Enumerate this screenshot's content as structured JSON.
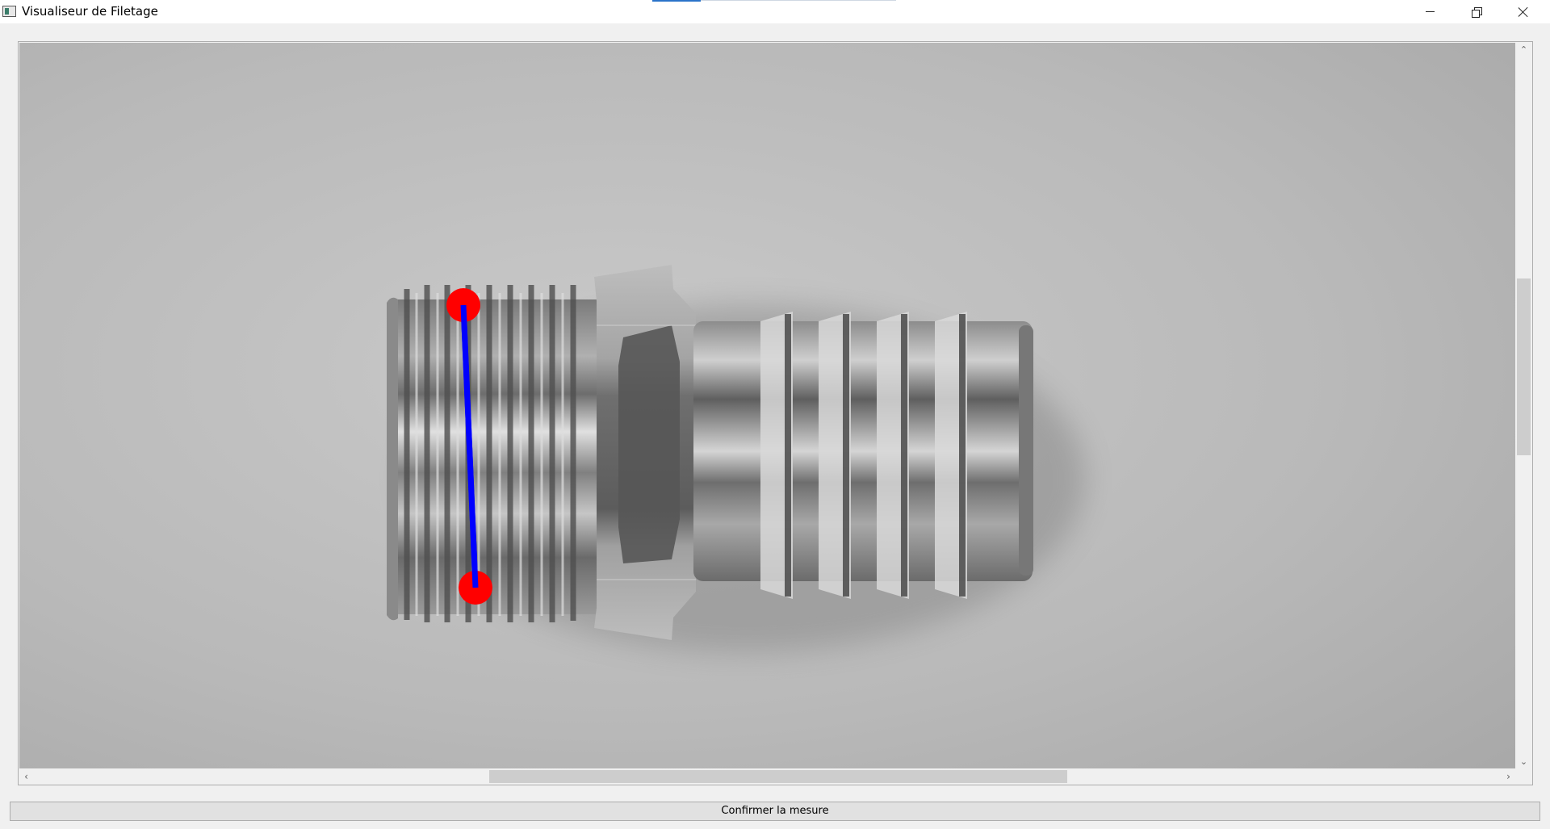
{
  "window": {
    "title": "Visualiseur de Filetage",
    "app_icon": "window-app-icon",
    "controls": {
      "minimize_icon": "minimize-icon",
      "maximize_icon": "restore-icon",
      "close_icon": "close-icon"
    }
  },
  "viewer": {
    "image_subject": "threaded hose barb fitting (grayscale photo)",
    "measurement": {
      "line_color": "#0000ff",
      "handle_color": "#ff0000"
    },
    "scrollbars": {
      "vertical": {
        "up_icon": "chevron-up-icon",
        "down_icon": "chevron-down-icon"
      },
      "horizontal": {
        "left_icon": "chevron-left-icon",
        "right_icon": "chevron-right-icon"
      }
    }
  },
  "actions": {
    "confirm_label": "Confirmer la mesure"
  },
  "colors": {
    "title_bar": "#ffffff",
    "window_bg": "#f0f0f0",
    "scroll_thumb": "#cdcdcd",
    "button_bg": "#e1e1e1"
  }
}
